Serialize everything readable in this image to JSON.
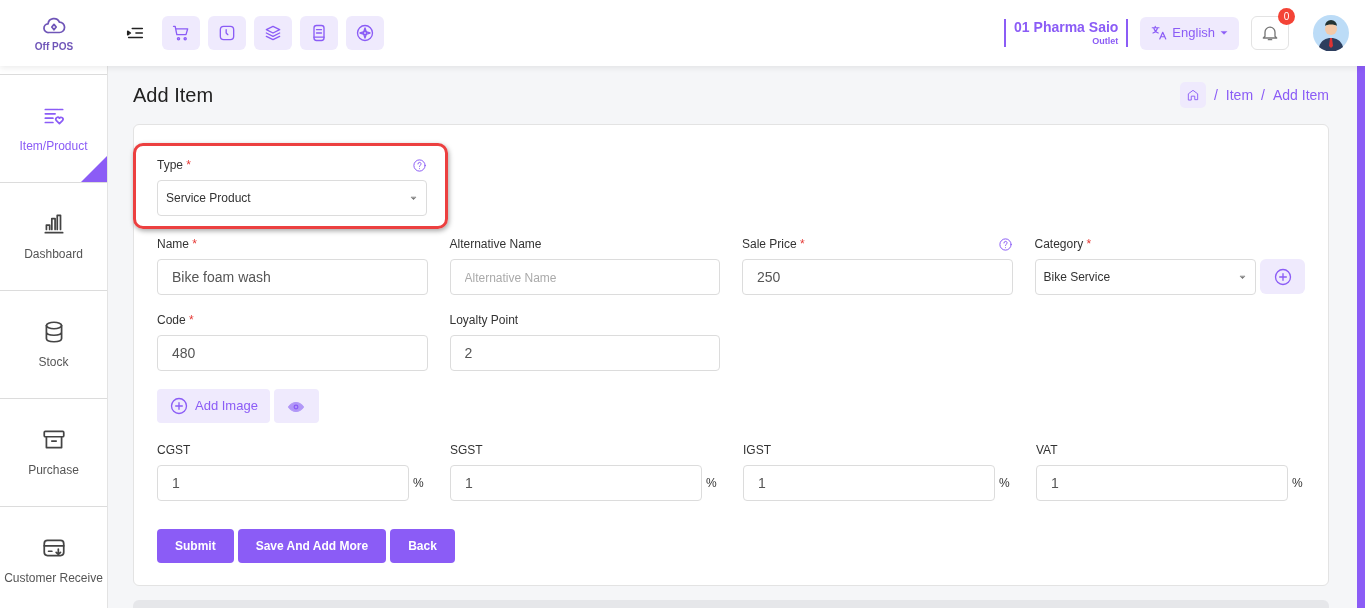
{
  "logo": {
    "text": "Off POS"
  },
  "outlet": {
    "name": "01 Pharma Saio",
    "label": "Outlet"
  },
  "language": {
    "label": "English"
  },
  "notifications": {
    "count": "0"
  },
  "sidebar": {
    "items": [
      {
        "label": "Item/Product",
        "selected": true
      },
      {
        "label": "Dashboard",
        "selected": false
      },
      {
        "label": "Stock",
        "selected": false
      },
      {
        "label": "Purchase",
        "selected": false
      },
      {
        "label": "Customer Receive",
        "selected": false
      }
    ]
  },
  "page_title": "Add Item",
  "breadcrumb": [
    {
      "separator": "/",
      "label": "Item"
    },
    {
      "separator": "/",
      "label": "Add Item"
    }
  ],
  "type_field": {
    "label": "Type",
    "required_mark": "*",
    "value": "Service Product",
    "help": true,
    "highlighted": true
  },
  "fields": [
    {
      "kind": "input",
      "label": "Name",
      "required_mark": "*",
      "value": "Bike foam wash",
      "help": false
    },
    {
      "kind": "input",
      "label": "Alternative Name",
      "placeholder": "Alternative Name",
      "help": false
    },
    {
      "kind": "input",
      "label": "Sale Price",
      "required_mark": "*",
      "value": "250",
      "help": true
    },
    {
      "kind": "select",
      "label": "Category",
      "required_mark": "*",
      "value": "Bike Service",
      "help": false
    },
    {
      "kind": "input",
      "label": "Code",
      "required_mark": "*",
      "value": "480",
      "help": false
    },
    {
      "kind": "input",
      "label": "Loyalty Point",
      "value": "2",
      "help": false
    }
  ],
  "add_image": {
    "label": "Add Image"
  },
  "taxes": [
    {
      "label": "CGST",
      "value": "1",
      "unit": "%"
    },
    {
      "label": "SGST",
      "value": "1",
      "unit": "%"
    },
    {
      "label": "IGST",
      "value": "1",
      "unit": "%"
    },
    {
      "label": "VAT",
      "value": "1",
      "unit": "%"
    }
  ],
  "buttons": [
    "Submit",
    "Save And Add More",
    "Back"
  ]
}
